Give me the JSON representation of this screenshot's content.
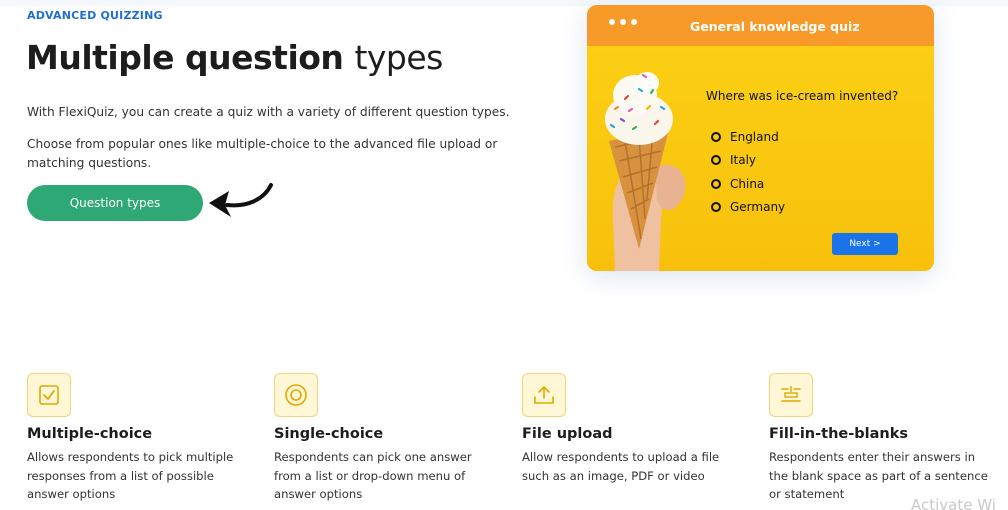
{
  "hero": {
    "eyebrow": "ADVANCED QUIZZING",
    "headline_bold": "Multiple question",
    "headline_light": "types",
    "description_1": "With FlexiQuiz, you can create a quiz with a variety of different question types.",
    "description_2": "Choose from popular ones like multiple-choice to the advanced file upload or matching questions.",
    "cta_label": "Question types"
  },
  "quiz_card": {
    "title": "General knowledge quiz",
    "question": "Where was ice-cream invented?",
    "options": [
      "England",
      "Italy",
      "China",
      "Germany"
    ],
    "next_label": "Next >",
    "header_color": "#f79a2a",
    "body_color": "#f8c410",
    "button_color": "#1a73e8"
  },
  "features": [
    {
      "icon": "checkbox-icon",
      "title": "Multiple-choice",
      "description": "Allows respondents to pick multiple responses from a list of possible answer options"
    },
    {
      "icon": "radio-target-icon",
      "title": "Single-choice",
      "description": "Respondents can pick one answer from a list or drop-down menu of answer options"
    },
    {
      "icon": "upload-icon",
      "title": "File upload",
      "description": "Allow respondents to upload a file such as an image, PDF or video"
    },
    {
      "icon": "blanks-icon",
      "title": "Fill-in-the-blanks",
      "description": "Respondents enter their answers in the blank space as part of a sentence or statement"
    }
  ],
  "overlay": {
    "watermark": "Activate Wi"
  },
  "colors": {
    "accent_blue": "#1f6fd1",
    "cta_green": "#2ea874",
    "icon_tile": "#fff7d6"
  }
}
